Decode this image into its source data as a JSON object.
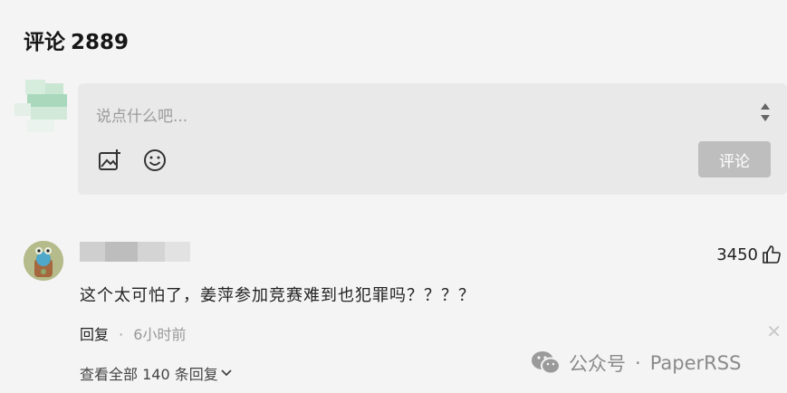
{
  "header": {
    "title": "评论",
    "count": "2889"
  },
  "composer": {
    "placeholder": "说点什么吧...",
    "image_icon": "image-add-icon",
    "emoji_icon": "smile-icon",
    "submit_label": "评论"
  },
  "comments": [
    {
      "text": "这个太可怕了，姜萍参加竞赛难到也犯罪吗？？？？",
      "likes": "3450",
      "reply_label": "回复",
      "separator": "·",
      "time": "6小时前",
      "view_all": "查看全部 140 条回复"
    }
  ],
  "watermark": {
    "prefix": "公众号",
    "separator": "·",
    "name": "PaperRSS"
  },
  "colors": {
    "editor_bg": "#e9e9e9",
    "submit_bg": "#bebebe",
    "page_bg": "#f4f4f4"
  }
}
